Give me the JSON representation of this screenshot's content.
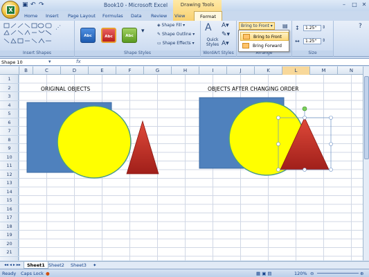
{
  "window": {
    "title": "Book10 - Microsoft Excel",
    "context_title": "Drawing Tools"
  },
  "tabs": [
    "Home",
    "Insert",
    "Page Layout",
    "Formulas",
    "Data",
    "Review",
    "View",
    "Format"
  ],
  "ribbon": {
    "insert_shapes_label": "Insert Shapes",
    "shape_styles_label": "Shape Styles",
    "style_button_text": "Abc",
    "shape_fill": "Shape Fill",
    "shape_outline": "Shape Outline",
    "shape_effects": "Shape Effects",
    "quick_styles": "Quick Styles",
    "wordart_label": "WordArt Styles",
    "bring_to_front": "Bring to Front",
    "arrange_label": "Arrange",
    "size_label": "Size",
    "height": "1.25\"",
    "width": "1.25\""
  },
  "menu": {
    "items": [
      "Bring to Front",
      "Bring Forward"
    ]
  },
  "namebox": "Shape 10",
  "columns": [
    "B",
    "C",
    "D",
    "E",
    "F",
    "G",
    "H",
    "I",
    "J",
    "K",
    "L",
    "M",
    "N"
  ],
  "rows": [
    "1",
    "2",
    "3",
    "4",
    "5",
    "6",
    "7",
    "8",
    "9",
    "10",
    "11",
    "12",
    "13",
    "14",
    "15",
    "16",
    "17",
    "18",
    "19",
    "20",
    "21"
  ],
  "sheet": {
    "label_original": "ORIGINAL OBJECTS",
    "label_after": "OBJECTS AFTER CHANGING ORDER"
  },
  "sheets": [
    "Sheet1",
    "Sheet2",
    "Sheet3"
  ],
  "status": {
    "ready": "Ready",
    "caps": "Caps Lock",
    "zoom": "120%"
  },
  "colors": {
    "blue": "#4f81bd",
    "yellow": "#ffff00",
    "red": "#c0392b",
    "selection": "#6a8fc5"
  }
}
